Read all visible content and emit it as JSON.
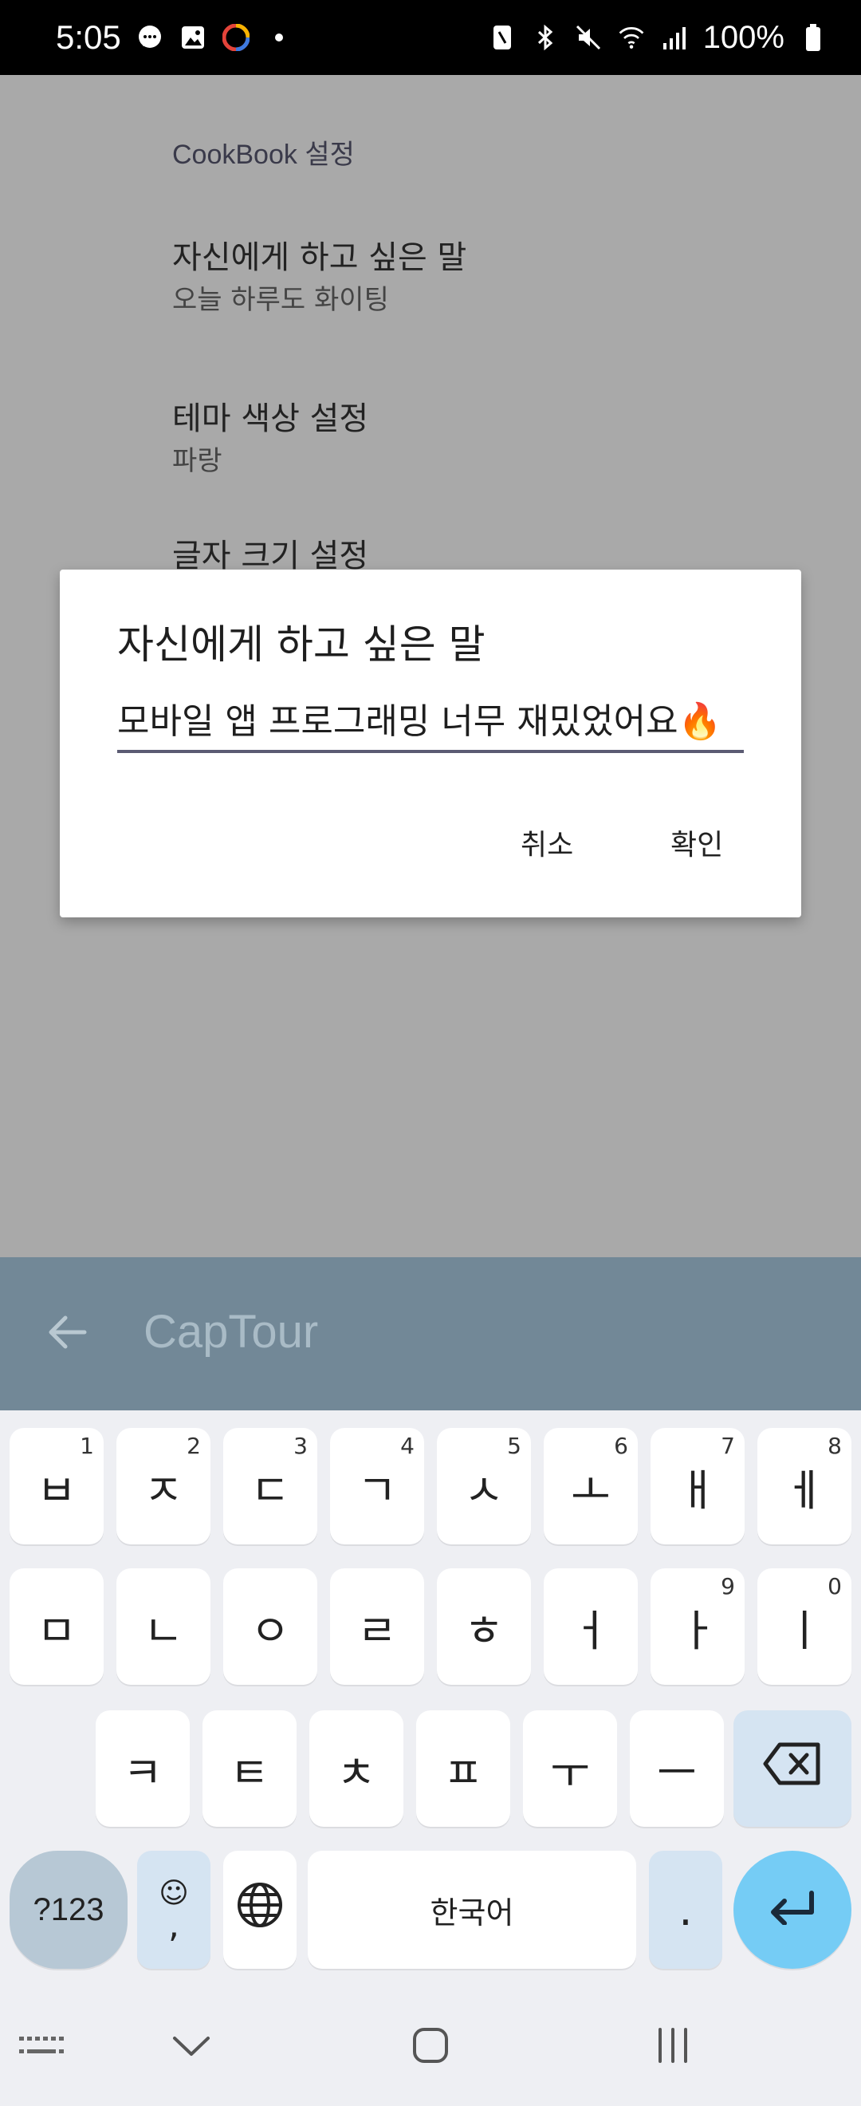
{
  "status_bar": {
    "time": "5:05",
    "battery": "100%",
    "left_icons": [
      "chat-icon",
      "gallery-icon",
      "app-icon",
      "dot-icon"
    ],
    "right_icons": [
      "nfc-icon",
      "bluetooth-icon",
      "mute-icon",
      "wifi-icon",
      "signal-icon",
      "battery-icon"
    ]
  },
  "settings": {
    "category": "CookBook 설정",
    "items": [
      {
        "title": "자신에게 하고 싶은 말",
        "summary": "오늘 하루도 화이팅"
      },
      {
        "title": "테마 색상 설정",
        "summary": "파랑"
      },
      {
        "title": "글자 크기 설정",
        "summary": ""
      }
    ]
  },
  "dialog": {
    "title": "자신에게 하고 싶은 말",
    "input_value": "모바일 앱 프로그래밍 너무 재밌었어요",
    "input_emoji": "🔥",
    "cancel_label": "취소",
    "ok_label": "확인"
  },
  "toolbar": {
    "title": "CapTour"
  },
  "keyboard": {
    "row1": [
      {
        "label": "ㅂ",
        "hint": "1"
      },
      {
        "label": "ㅈ",
        "hint": "2"
      },
      {
        "label": "ㄷ",
        "hint": "3"
      },
      {
        "label": "ㄱ",
        "hint": "4"
      },
      {
        "label": "ㅅ",
        "hint": "5"
      },
      {
        "label": "ㅗ",
        "hint": "6"
      },
      {
        "label": "ㅐ",
        "hint": "7"
      },
      {
        "label": "ㅔ",
        "hint": "8"
      }
    ],
    "row2": [
      {
        "label": "ㅁ",
        "hint": ""
      },
      {
        "label": "ㄴ",
        "hint": ""
      },
      {
        "label": "ㅇ",
        "hint": ""
      },
      {
        "label": "ㄹ",
        "hint": ""
      },
      {
        "label": "ㅎ",
        "hint": ""
      },
      {
        "label": "ㅓ",
        "hint": ""
      },
      {
        "label": "ㅏ",
        "hint": "9"
      },
      {
        "label": "ㅣ",
        "hint": "0"
      }
    ],
    "row3": [
      "ㅋ",
      "ㅌ",
      "ㅊ",
      "ㅍ",
      "ㅜ",
      "ㅡ"
    ],
    "symbols_label": "?123",
    "emoji_top": "☺",
    "emoji_bottom": ",",
    "space_label": "한국어",
    "period_label": "."
  }
}
